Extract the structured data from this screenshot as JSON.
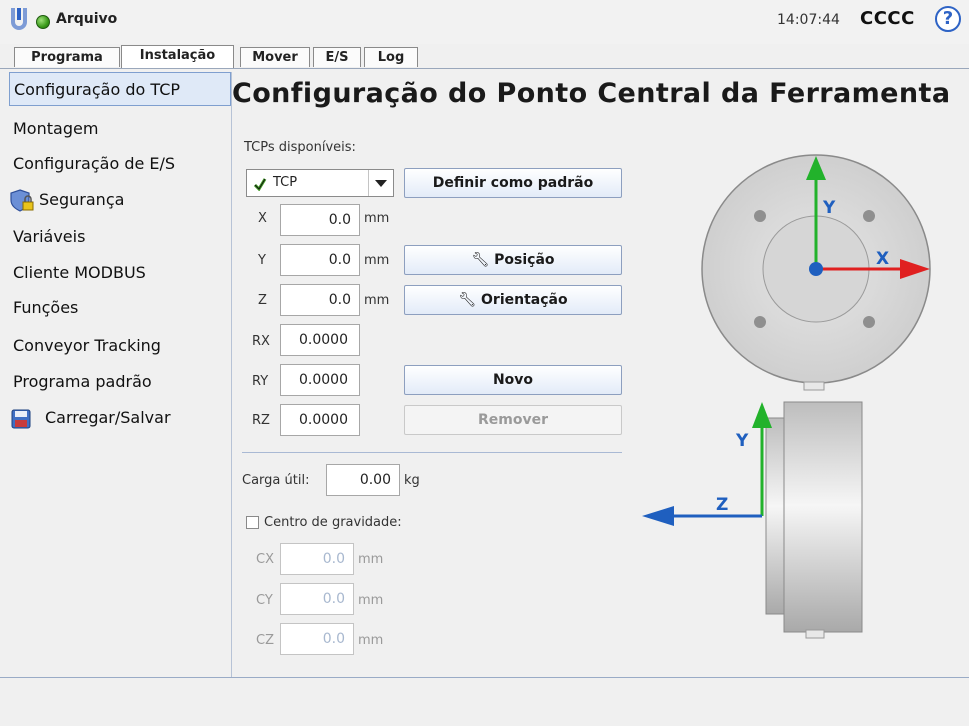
{
  "topbar": {
    "menu_label": "Arquivo",
    "time": "14:07:44",
    "robot_name": "CCCC",
    "help_glyph": "?"
  },
  "tabs": [
    {
      "label": "Programa",
      "active": false
    },
    {
      "label": "Instalação",
      "active": true
    },
    {
      "label": "Mover",
      "active": false
    },
    {
      "label": "E/S",
      "active": false
    },
    {
      "label": "Log",
      "active": false
    }
  ],
  "nav": {
    "items": [
      {
        "label": "Configuração do TCP",
        "active": true
      },
      {
        "label": "Montagem"
      },
      {
        "label": "Configuração de E/S"
      },
      {
        "label": "Segurança",
        "icon": "shield-lock-icon"
      },
      {
        "label": "Variáveis"
      },
      {
        "label": "Cliente MODBUS"
      },
      {
        "label": "Funções"
      },
      {
        "label": "Conveyor Tracking"
      },
      {
        "label": "Programa padrão"
      },
      {
        "label": "Carregar/Salvar",
        "icon": "floppy-disk-icon"
      }
    ]
  },
  "main": {
    "title": "Configuração do Ponto Central da Ferramenta",
    "available_label": "TCPs disponíveis:",
    "selected_tcp": "TCP",
    "set_default_label": "Definir como padrão",
    "position_label": "Posição",
    "orientation_label": "Orientação",
    "new_label": "Novo",
    "remove_label": "Remover",
    "unit_mm": "mm",
    "unit_kg": "kg",
    "fields": {
      "x": {
        "label": "X",
        "value": "0.0"
      },
      "y": {
        "label": "Y",
        "value": "0.0"
      },
      "z": {
        "label": "Z",
        "value": "0.0"
      },
      "rx": {
        "label": "RX",
        "value": "0.0000"
      },
      "ry": {
        "label": "RY",
        "value": "0.0000"
      },
      "rz": {
        "label": "RZ",
        "value": "0.0000"
      }
    },
    "payload_label": "Carga útil:",
    "payload_value": "0.00",
    "cog_label": "Centro de gravidade:",
    "cog": {
      "cx": {
        "label": "CX",
        "value": "0.0"
      },
      "cy": {
        "label": "CY",
        "value": "0.0"
      },
      "cz": {
        "label": "CZ",
        "value": "0.0"
      }
    }
  },
  "diagram": {
    "top_x": "X",
    "top_y": "Y",
    "side_y": "Y",
    "side_z": "Z"
  },
  "colors": {
    "accent": "#2e63c5",
    "axis_x": "#e02020",
    "axis_y": "#22b22b",
    "axis_z": "#1f5fbf"
  }
}
